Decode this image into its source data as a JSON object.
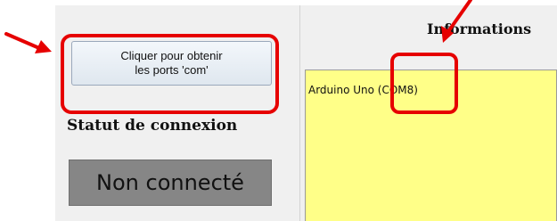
{
  "left_panel": {
    "get_ports_button_label": "Cliquer pour obtenir\nles ports 'com'",
    "status_title": "Statut de connexion",
    "status_value": "Non connecté",
    "status_color": "#868686"
  },
  "right_panel": {
    "info_title": "Informations",
    "ports": [
      "Arduino Uno (COM8)"
    ],
    "list_background": "#ffff88"
  },
  "annotations": {
    "color": "#e60000"
  }
}
